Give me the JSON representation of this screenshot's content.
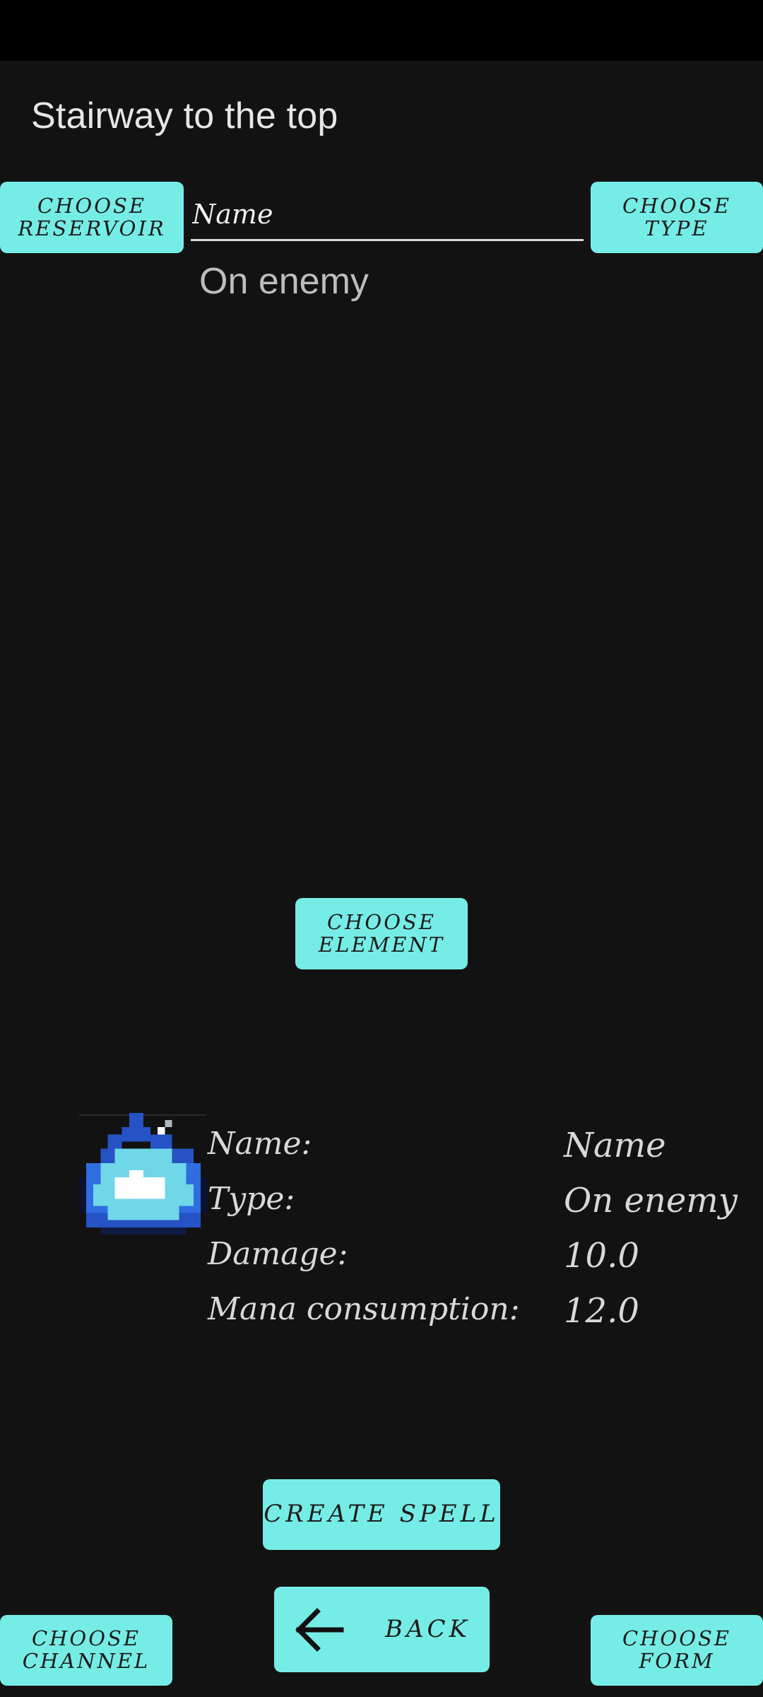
{
  "app": {
    "title": "Stairway to the top"
  },
  "buttons": {
    "reservoir": "CHOOSE\nRESERVOIR",
    "type": "CHOOSE\nTYPE",
    "element": "CHOOSE\nELEMENT",
    "create": "CREATE SPELL",
    "back": "BACK",
    "channel": "CHOOSE\nCHANNEL",
    "form": "CHOOSE\nFORM"
  },
  "name_input": {
    "placeholder": "Name",
    "value": ""
  },
  "spell_type_subtitle": "On enemy",
  "stats": {
    "name_label": "Name:",
    "name_value": "Name",
    "type_label": "Type:",
    "type_value": "On enemy",
    "damage_label": "Damage:",
    "damage_value": "10.0",
    "mana_label": "Mana consumption:",
    "mana_value": "12.0"
  },
  "icons": {
    "spell": "blue-flame-icon",
    "back": "arrow-left-icon"
  },
  "colors": {
    "background": "#121212",
    "accent": "#75ede6",
    "status_bar": "#000000"
  }
}
